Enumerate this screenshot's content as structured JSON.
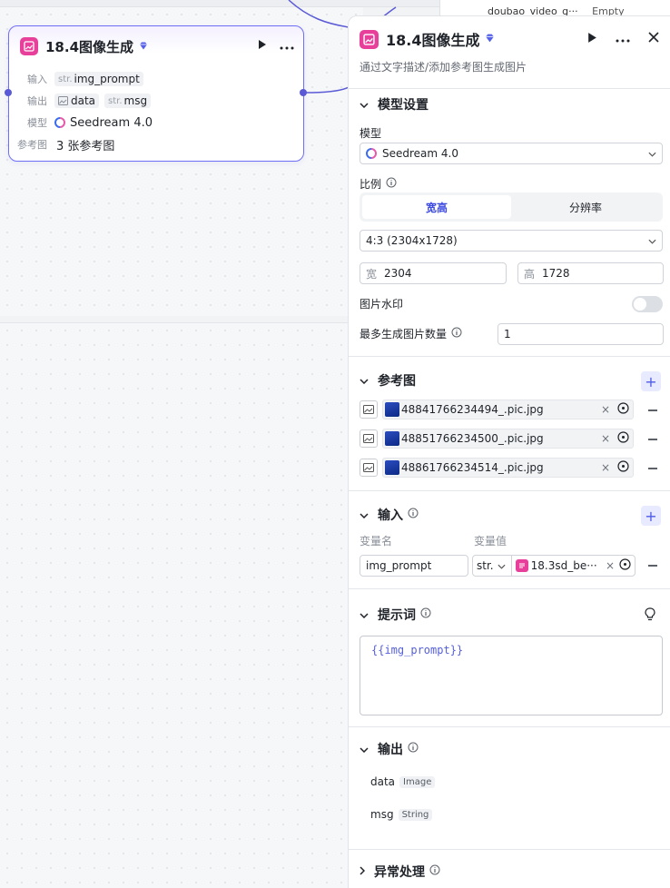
{
  "background": {
    "partial_node_text": "doubao_video_g···",
    "partial_node_text2": "Empty"
  },
  "node": {
    "title": "18.4图像生成",
    "input_label": "输入",
    "input_prefix": "str.",
    "input_value": "img_prompt",
    "output_label": "输出",
    "output_data": "data",
    "output_msg_prefix": "str.",
    "output_msg": "msg",
    "model_label": "模型",
    "model_value": "Seedream 4.0",
    "ref_label": "参考图",
    "ref_value": "3 张参考图"
  },
  "panel": {
    "title": "18.4图像生成",
    "description": "通过文字描述/添加参考图生成图片",
    "model_section": {
      "header": "模型设置",
      "model_label": "模型",
      "model_value": "Seedream 4.0",
      "ratio_label": "比例",
      "tab_wh": "宽高",
      "tab_res": "分辨率",
      "ratio_value": "4:3 (2304x1728)",
      "width_prefix": "宽",
      "width_value": "2304",
      "height_prefix": "高",
      "height_value": "1728",
      "watermark_label": "图片水印",
      "watermark_on": false,
      "max_count_label": "最多生成图片数量",
      "max_count_value": "1"
    },
    "ref_section": {
      "header": "参考图",
      "items": [
        {
          "name": "48841766234494_.pic.jpg"
        },
        {
          "name": "48851766234500_.pic.jpg"
        },
        {
          "name": "48861766234514_.pic.jpg"
        }
      ]
    },
    "input_section": {
      "header": "输入",
      "col_name": "变量名",
      "col_value": "变量值",
      "var_name": "img_prompt",
      "var_type": "str.",
      "var_ref": "18.3sd_be···"
    },
    "prompt_section": {
      "header": "提示词",
      "content": "{{img_prompt}}"
    },
    "output_section": {
      "header": "输出",
      "items": [
        {
          "name": "data",
          "type": "Image"
        },
        {
          "name": "msg",
          "type": "String"
        }
      ]
    },
    "error_section": {
      "header": "异常处理"
    }
  },
  "colors": {
    "accent": "#4e5be8",
    "node_icon": "#e8409a",
    "node_border": "#6f6ff6"
  }
}
